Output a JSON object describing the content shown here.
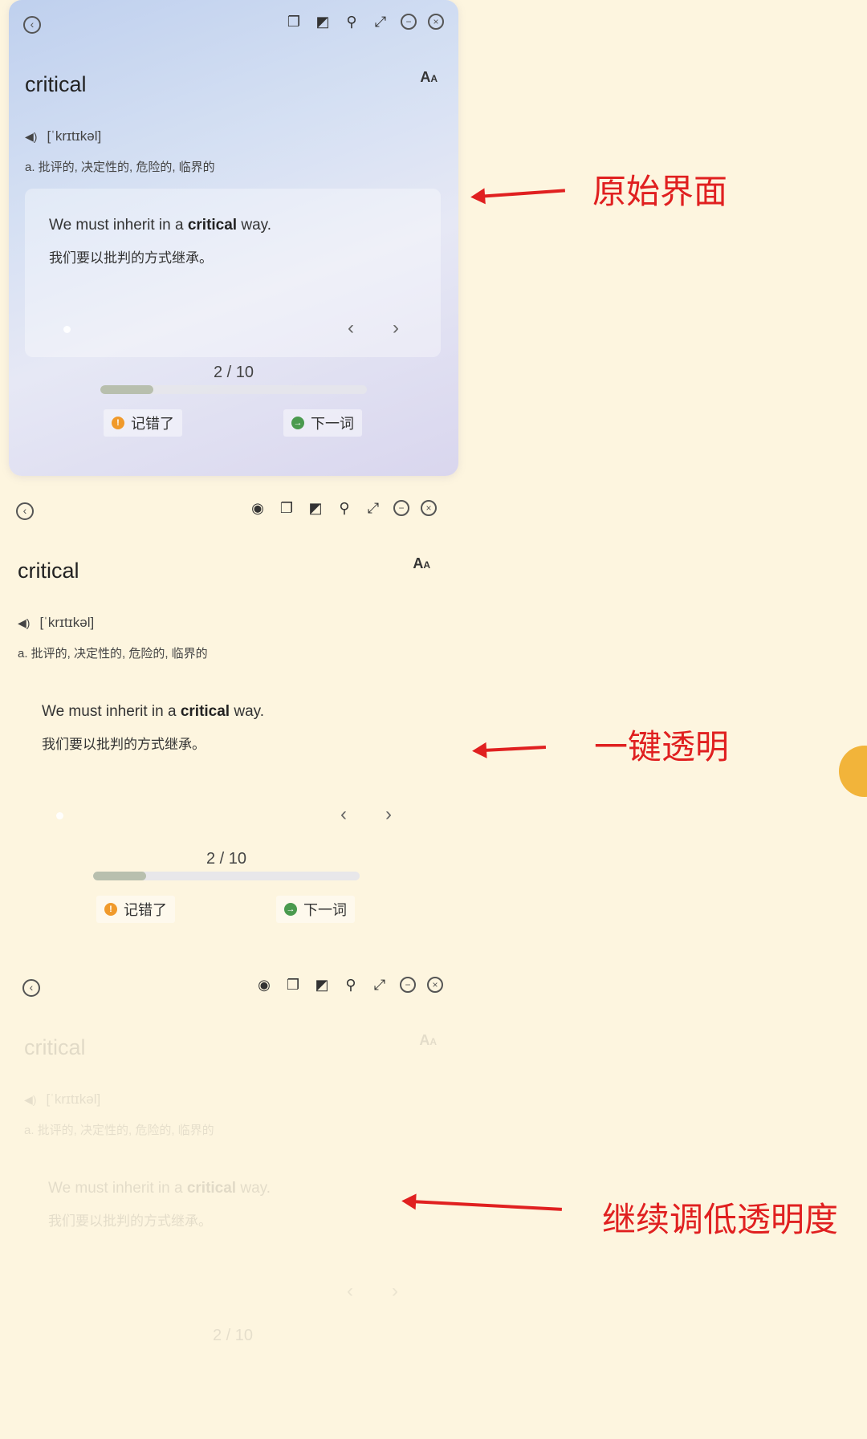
{
  "panels": [
    {
      "label": "原始界面",
      "word": "critical",
      "font_btn": "A",
      "font_btn_small": "A",
      "phonetic": "[ˈkrɪtɪkəl]",
      "definition": "a. 批评的, 决定性的, 危险的, 临界的",
      "sentence_pre": "We must inherit in a ",
      "sentence_bold": "critical",
      "sentence_post": " way.",
      "translation": "我们要以批判的方式继承。",
      "progress": "2 / 10",
      "progress_fraction": 0.2,
      "btn_remember": "记错了",
      "btn_next": "下一词"
    },
    {
      "label": "一键透明",
      "word": "critical",
      "font_btn": "A",
      "font_btn_small": "A",
      "phonetic": "[ˈkrɪtɪkəl]",
      "definition": "a. 批评的, 决定性的, 危险的, 临界的",
      "sentence_pre": "We must inherit in a ",
      "sentence_bold": "critical",
      "sentence_post": " way.",
      "translation": "我们要以批判的方式继承。",
      "progress": "2 / 10",
      "progress_fraction": 0.2,
      "btn_remember": "记错了",
      "btn_next": "下一词"
    },
    {
      "label": "继续调低透明度",
      "word": "critical",
      "font_btn": "A",
      "font_btn_small": "A",
      "phonetic": "[ˈkrɪtɪkəl]",
      "definition": "a. 批评的, 决定性的, 危险的, 临界的",
      "sentence_pre": "We must inherit in a ",
      "sentence_bold": "critical",
      "sentence_post": " way.",
      "translation": "我们要以批判的方式继承。",
      "progress": "2 / 10",
      "progress_fraction": 0.2
    }
  ],
  "icons": {
    "back": "back-icon",
    "eye": "eye-icon",
    "copy": "copy-icon",
    "contrast": "contrast-icon",
    "pin": "pin-icon",
    "expand": "expand-icon",
    "minimize": "minimize-icon",
    "close": "close-icon",
    "speaker": "speaker-icon"
  },
  "colors": {
    "accent_red": "#e02020",
    "orange_badge": "#f09a2b",
    "green_badge": "#4a9a4e",
    "background": "#fdf5df"
  }
}
